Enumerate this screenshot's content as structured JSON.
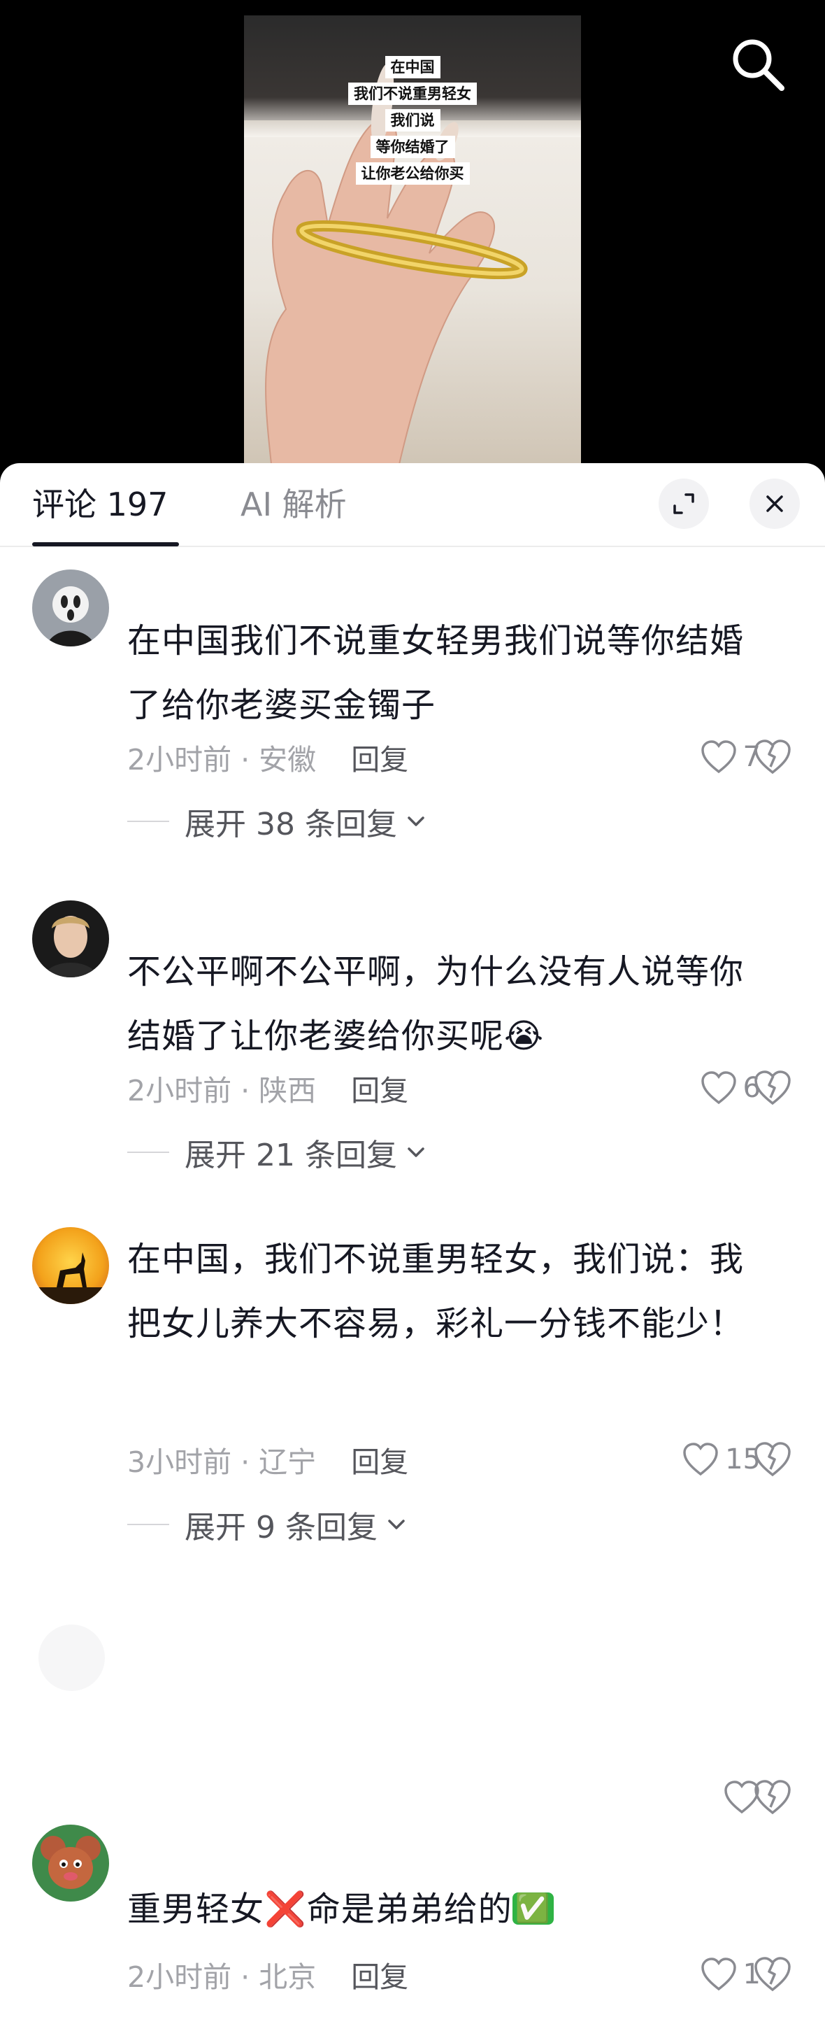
{
  "video": {
    "captions": [
      "在中国",
      "我们不说重男轻女",
      "我们说",
      "等你结婚了",
      "让你老公给你买"
    ]
  },
  "tabs": {
    "comments_label": "评论 197",
    "ai_label": "AI 解析"
  },
  "comments": [
    {
      "text": "在中国我们不说重女轻男我们说等你结婚了给你老婆买金镯子",
      "time_location": "2小时前 · 安徽",
      "reply_label": "回复",
      "likes": "7",
      "expand_label": "展开 38 条回复"
    },
    {
      "text": "不公平啊不公平啊，为什么没有人说等你结婚了让你老婆给你买呢",
      "emoji": "😭",
      "time_location": "2小时前 · 陕西",
      "reply_label": "回复",
      "likes": "6",
      "expand_label": "展开 21 条回复"
    },
    {
      "text": "在中国，我们不说重男轻女，我们说：我把女儿养大不容易，彩礼一分钱不能少！",
      "time_location": "3小时前 · 辽宁",
      "reply_label": "回复",
      "likes": "15",
      "expand_label": "展开 9 条回复"
    },
    {
      "text": "",
      "likes": ""
    },
    {
      "text_a": "重男轻女",
      "mark_a": "❌",
      "text_b": "命是弟弟给的",
      "mark_b": "✅",
      "time_location": "2小时前 · 北京",
      "reply_label": "回复",
      "likes": "1"
    }
  ],
  "colors": {
    "text_primary": "#161823",
    "text_secondary": "#a2a3a8",
    "sheet_bg": "#ffffff",
    "video_bg": "#000000"
  },
  "icons": [
    "search-icon",
    "expand-icon",
    "close-icon",
    "heart-icon",
    "dislike-heart-icon",
    "chevron-down-icon"
  ]
}
